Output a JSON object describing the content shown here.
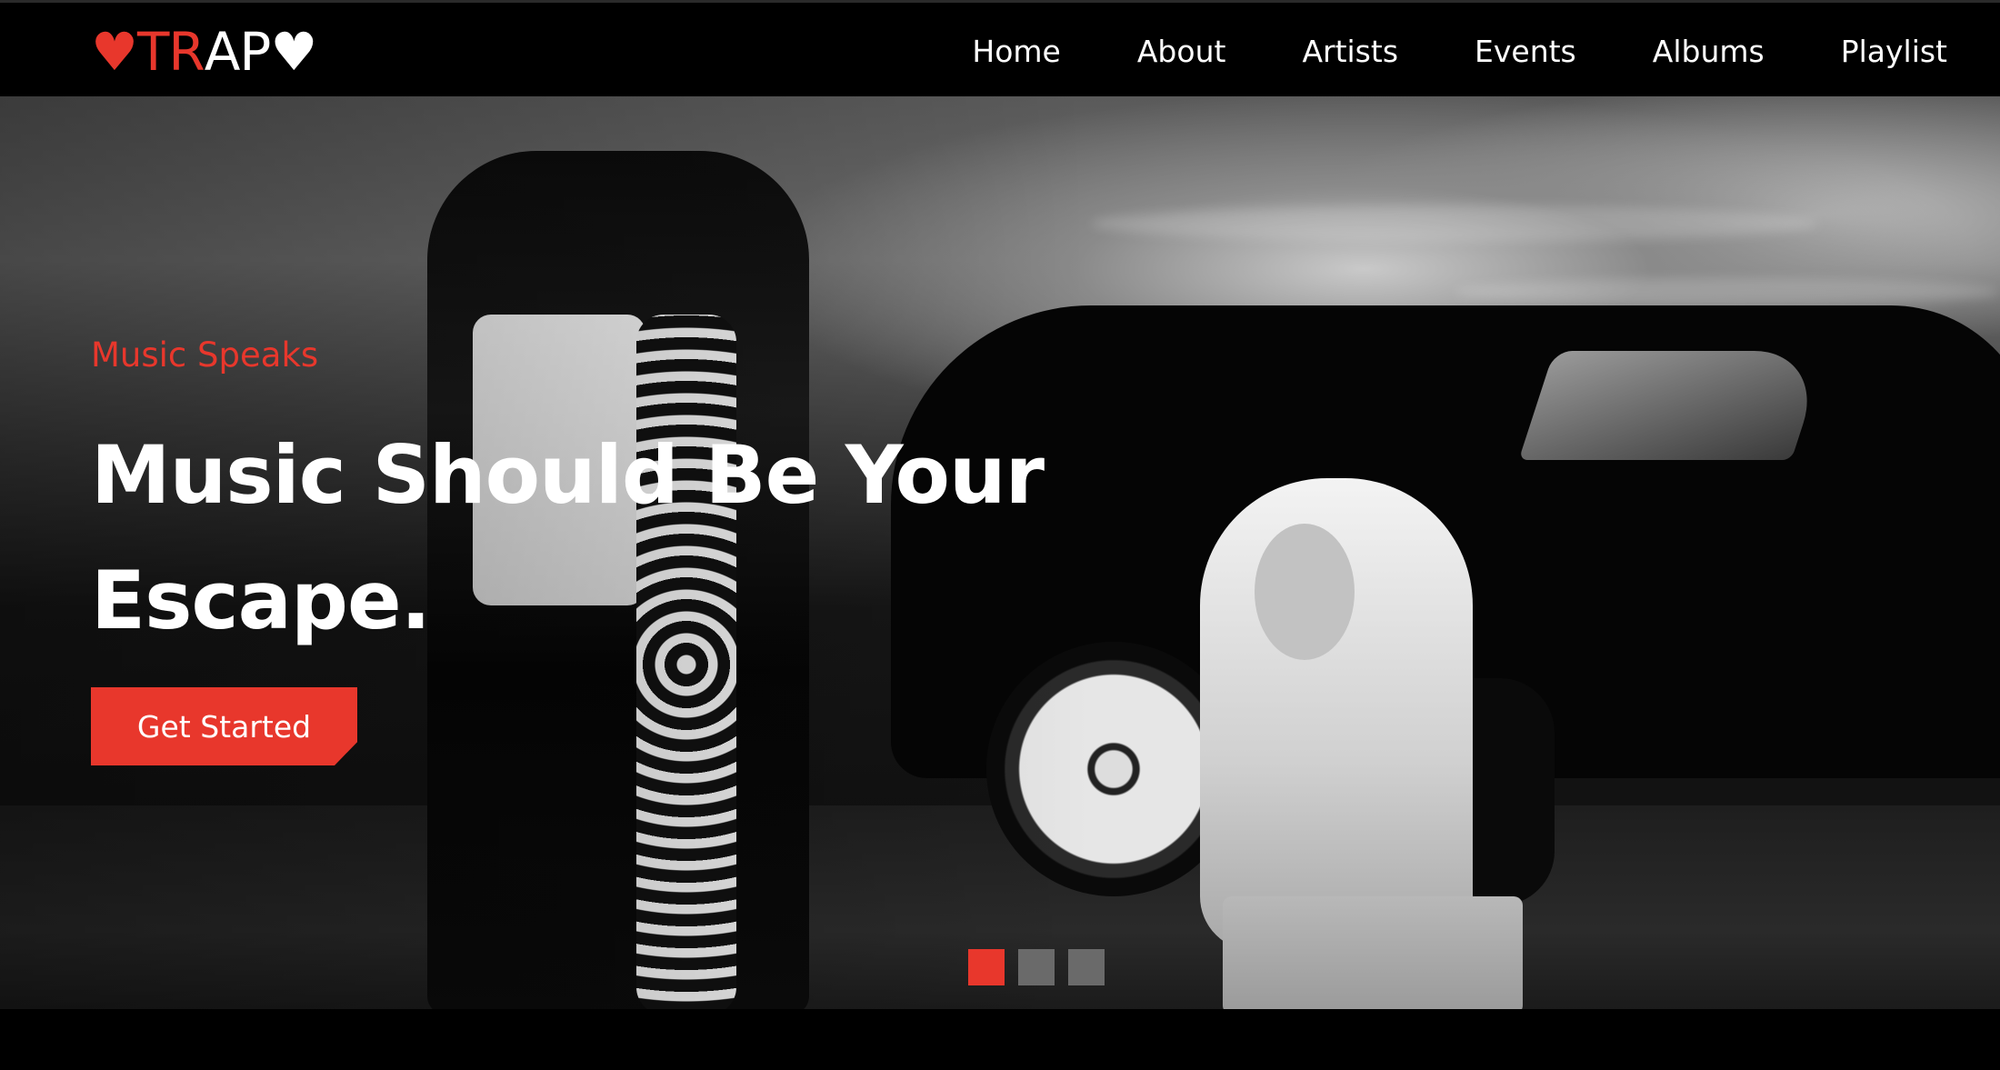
{
  "brand": {
    "logo_left_heart": "♥",
    "logo_red_text": "TR",
    "logo_white_text": "AP",
    "logo_right_heart": "♥",
    "accent_color": "#e8372c"
  },
  "nav": {
    "items": [
      {
        "label": "Home"
      },
      {
        "label": "About"
      },
      {
        "label": "Artists"
      },
      {
        "label": "Events"
      },
      {
        "label": "Albums"
      },
      {
        "label": "Playlist"
      }
    ]
  },
  "hero": {
    "eyebrow": "Music Speaks",
    "headline": "Music Should Be Your Escape.",
    "cta_label": "Get Started",
    "slides": {
      "count": 3,
      "active_index": 0
    }
  }
}
